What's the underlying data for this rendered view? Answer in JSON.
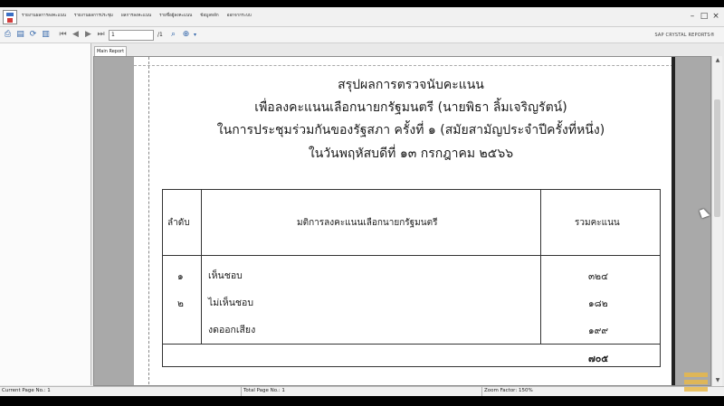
{
  "menu": {
    "items": [
      "รายงานผลการลงคะแนน",
      "รายงานผลการประชุม",
      "ผลการลงคะแนน",
      "รายชื่อผู้ลงคะแนน",
      "ข้อมูลหลัก",
      "ออกจากระบบ"
    ]
  },
  "toolbar": {
    "page_input": "1",
    "page_total": "/1",
    "brand": "SAP CRYSTAL REPORTS®"
  },
  "tab": {
    "label": "Main Report"
  },
  "report": {
    "title_lines": [
      "สรุปผลการตรวจนับคะแนน",
      "เพื่อลงคะแนนเลือกนายกรัฐมนตรี (นายพิธา ลิ้มเจริญรัตน์)",
      "ในการประชุมร่วมกันของรัฐสภา ครั้งที่ ๑ (สมัยสามัญประจำปีครั้งที่หนึ่ง)",
      "ในวันพฤหัสบดีที่ ๑๓ กรกฎาคม ๒๕๖๖"
    ],
    "table": {
      "headers": [
        "ลำดับ",
        "มติการลงคะแนนเลือกนายกรัฐมนตรี",
        "รวมคะแนน"
      ],
      "rows": [
        {
          "no": "๑",
          "label": "เห็นชอบ",
          "count": "๓๒๔"
        },
        {
          "no": "๒",
          "label": "ไม่เห็นชอบ",
          "count": "๑๘๒"
        },
        {
          "no": "",
          "label": "งดออกเสียง",
          "count": "๑๙๙"
        }
      ],
      "total": "๗๐๕"
    }
  },
  "status": {
    "current_page": "Current Page No.: 1",
    "total_page": "Total Page No.: 1",
    "zoom": "Zoom Factor: 150%"
  },
  "colors": {
    "viewport_bg": "#a9a9a9",
    "page_bg": "#ffffff",
    "brand_accent": "#e8b84a"
  }
}
